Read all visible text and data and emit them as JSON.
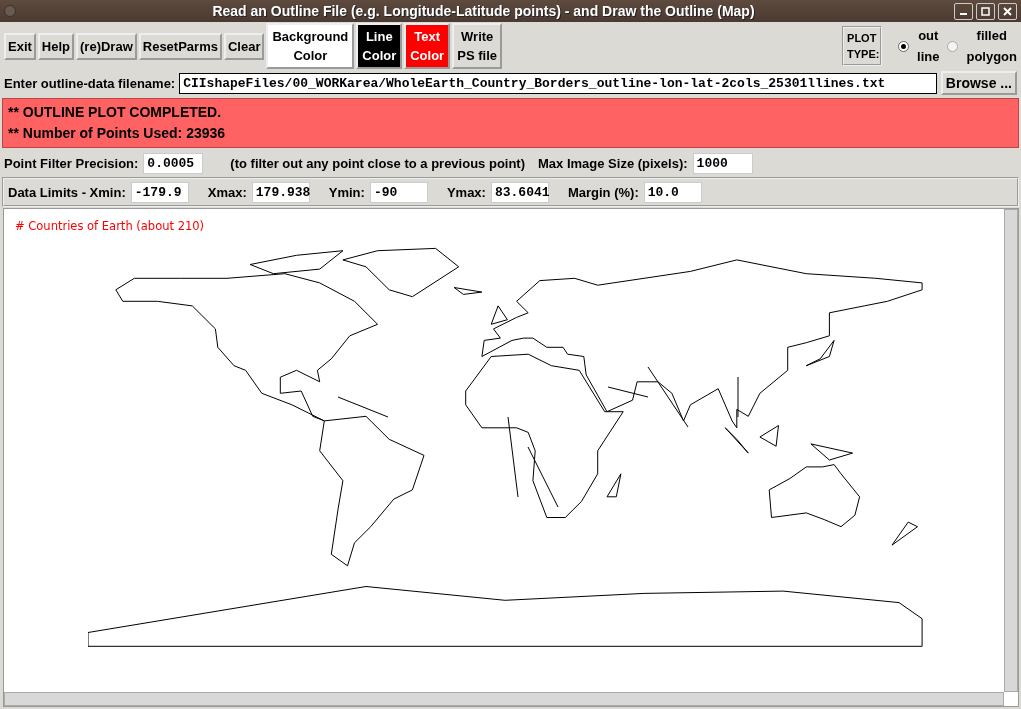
{
  "window": {
    "title": "Read an Outline File (e.g. Longitude-Latitude points) - and Draw the Outline (Map)"
  },
  "toolbar": {
    "buttons": [
      {
        "label": "Exit",
        "kind": "plain"
      },
      {
        "label": "Help",
        "kind": "plain"
      },
      {
        "label": "(re)Draw",
        "kind": "plain"
      },
      {
        "label": "ResetParms",
        "kind": "plain"
      },
      {
        "label": "Clear",
        "kind": "plain"
      },
      {
        "label": "Background Color",
        "kind": "swatch",
        "color": "#ffffff"
      },
      {
        "label": "Line Color",
        "kind": "swatch",
        "color": "#000000"
      },
      {
        "label": "Text Color",
        "kind": "swatch",
        "color": "#ff0000"
      },
      {
        "label": "Write PS file",
        "kind": "plain"
      }
    ],
    "plot_type": {
      "label": "PLOT TYPE:",
      "options": [
        {
          "label": "out line",
          "selected": true
        },
        {
          "label": "filled polygon",
          "selected": false
        }
      ]
    }
  },
  "file": {
    "label": "Enter outline-data filename:",
    "value": "CIIshapeFiles/00_WORKarea/WholeEarth_Country_Borders_outline-lon-lat-2cols_25301llines.txt",
    "button": "Browse ..."
  },
  "status": {
    "lines": [
      "** OUTLINE PLOT COMPLETED.",
      "** Number of Points Used: 23936"
    ]
  },
  "filter_row": [
    {
      "kind": "field",
      "label": "Point Filter Precision:",
      "value": "0.0005"
    },
    {
      "kind": "note",
      "label": "(to filter out any point close to a previous point)"
    },
    {
      "kind": "field",
      "label": "Max Image Size (pixels):",
      "value": "1000"
    }
  ],
  "limits_row": [
    {
      "kind": "field",
      "label": "Data Limits - Xmin:",
      "value": "-179.9"
    },
    {
      "kind": "field",
      "label": "Xmax:",
      "value": "179.938"
    },
    {
      "kind": "field",
      "label": "Ymin:",
      "value": "-90"
    },
    {
      "kind": "field",
      "label": "Ymax:",
      "value": "83.6041"
    },
    {
      "kind": "field",
      "label": "Margin (%):",
      "value": "10.0"
    }
  ],
  "canvas": {
    "comment": "# Countries of Earth (about 210)"
  }
}
